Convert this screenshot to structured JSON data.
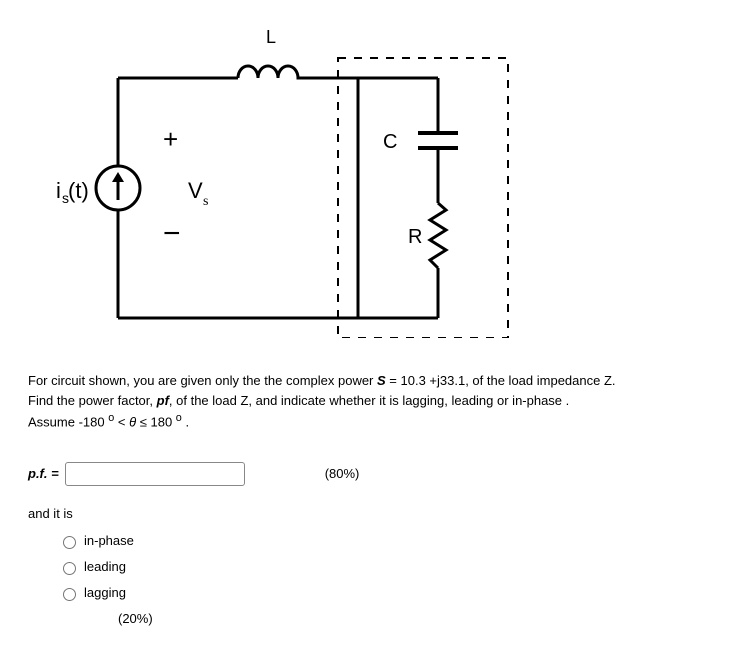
{
  "circuit": {
    "inductor_label": "L",
    "source_label": "iₛ(t)",
    "voltage_label": "Vₛ",
    "plus": "+",
    "minus": "−",
    "capacitor_label": "C",
    "resistor_label": "R"
  },
  "question": {
    "line1_part1": "For circuit shown, you are given only the the complex power  ",
    "line1_S": "S",
    "line1_part2": " = 10.3 +j33.1,  of the load   impedance Z.",
    "line2_part1": "Find  the power factor, ",
    "line2_pf": "pf",
    "line2_part2": ",   of the load Z,   and indicate  whether it is lagging,  leading or in-phase .",
    "line3_part1": "Assume    -180 ",
    "line3_deg1": "o",
    "line3_part2": " < ",
    "line3_theta": "θ",
    "line3_part3": "   ≤   180 ",
    "line3_deg2": "o",
    "line3_part4": " ."
  },
  "answer": {
    "pf_label": "p.f. =",
    "pf_value": "",
    "percent_80": "(80%)",
    "and_it_is": "and it is",
    "options": {
      "in_phase": "in-phase",
      "leading": "leading",
      "lagging": "lagging"
    },
    "percent_20": "(20%)"
  }
}
